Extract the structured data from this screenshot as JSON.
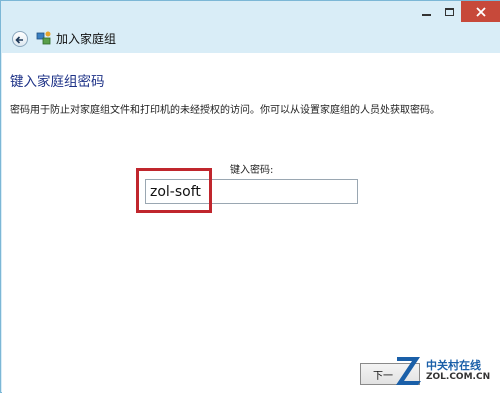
{
  "window": {
    "header_title": "加入家庭组"
  },
  "page": {
    "section_title": "键入家庭组密码",
    "description": "密码用于防止对家庭组文件和打印机的未经授权的访问。你可以从设置家庭组的人员处获取密码。",
    "password_label": "键入密码:",
    "password_value": "zol-soft",
    "next_button_label": "下一"
  },
  "watermark": {
    "line1": "中关村在线",
    "line2": "ZOL.COM.CN"
  },
  "colors": {
    "title_blue": "#1e3287",
    "frame": "#d9edf7",
    "close_red": "#c7493a",
    "highlight_red": "#c0262d"
  }
}
